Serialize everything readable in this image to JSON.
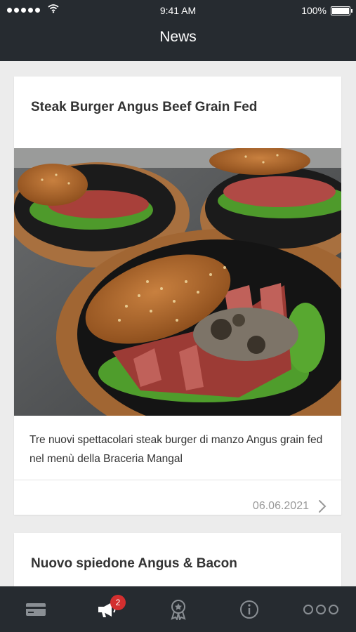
{
  "status_bar": {
    "time": "9:41 AM",
    "battery": "100%"
  },
  "nav": {
    "title": "News"
  },
  "articles": [
    {
      "title": "Steak Burger Angus Beef Grain Fed",
      "text": "Tre nuovi spettacolari steak burger di manzo Angus grain fed nel menù della Braceria Mangal",
      "date": "06.06.2021"
    },
    {
      "title": "Nuovo spiedone Angus & Bacon"
    }
  ],
  "tab_bar": {
    "tabs": [
      {
        "icon": "card-icon",
        "active": false
      },
      {
        "icon": "megaphone-icon",
        "active": true,
        "badge": "2"
      },
      {
        "icon": "award-icon",
        "active": false
      },
      {
        "icon": "info-icon",
        "active": false
      },
      {
        "icon": "more-icon",
        "active": false
      }
    ]
  },
  "colors": {
    "bar": "#262b30",
    "badge": "#d32f2f",
    "background": "#ececec"
  }
}
